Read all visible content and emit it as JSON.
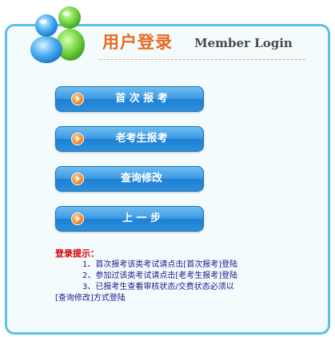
{
  "header": {
    "title_cn": "用户登录",
    "title_en": "Member Login",
    "icon": "users-icon"
  },
  "buttons": [
    {
      "label": "首 次 报 考",
      "icon": "arrow-right-icon"
    },
    {
      "label": "老考生报考",
      "icon": "arrow-right-icon"
    },
    {
      "label": "查询修改",
      "icon": "arrow-right-icon"
    },
    {
      "label": "上 一 步",
      "icon": "arrow-right-icon"
    }
  ],
  "tips": {
    "title": "登录提示：",
    "items": [
      "1、首次报考该类考试请点击[首次报考]登陆",
      "2、参加过该类考试请点击[老考生报考]登陆",
      "3、已报考生查看审核状态/交费状态必须以"
    ],
    "continuation": "[查询修改]方式登陆"
  },
  "colors": {
    "border": "#5cc0e4",
    "panel_bg": "#f4fbfd",
    "title_orange": "#ea6a20",
    "button_blue": "#2c8fdd",
    "tips_red": "#d00000",
    "tips_blue": "#1a1a8c"
  }
}
